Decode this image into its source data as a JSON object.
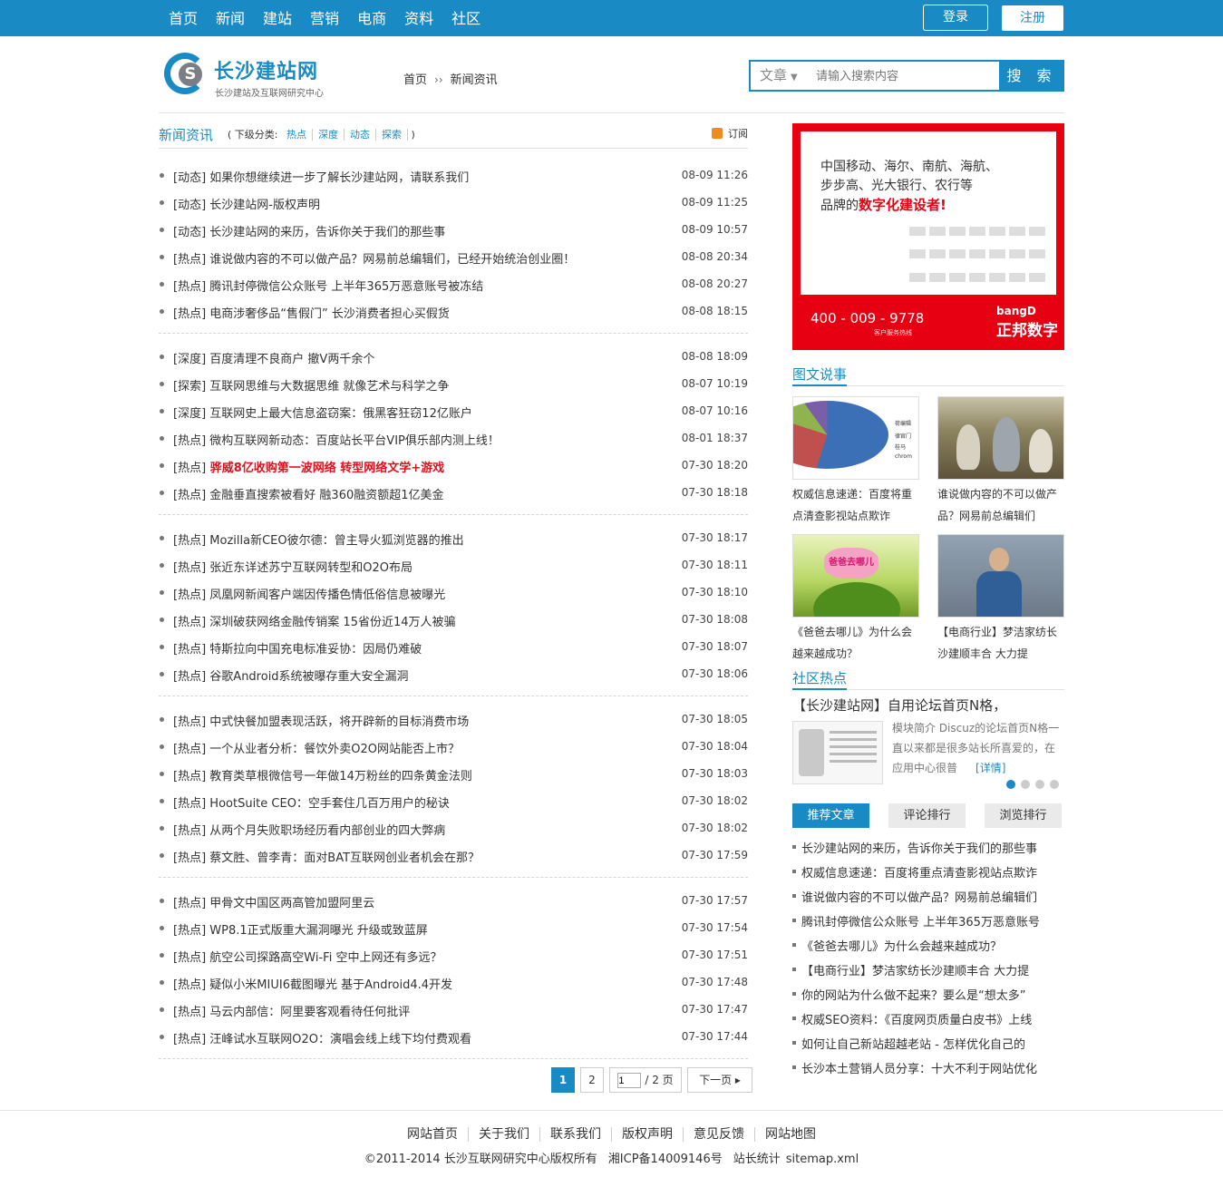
{
  "nav": {
    "items": [
      "首页",
      "新闻",
      "建站",
      "营销",
      "电商",
      "资料",
      "社区"
    ],
    "login": "登录",
    "register": "注册"
  },
  "logo": {
    "icon_letter": "S",
    "name": "长沙建站网",
    "subtitle": "长沙建站及互联网研究中心"
  },
  "breadcrumb": {
    "home": "首页",
    "separator": "››",
    "current": "新闻资讯"
  },
  "search": {
    "type": "文章",
    "placeholder": "请输入搜索内容",
    "button": "搜 索"
  },
  "list": {
    "title": "新闻资讯",
    "subcats_prefix": "( 下级分类:",
    "subcats": [
      "热点",
      "深度",
      "动态",
      "探索"
    ],
    "subcats_suffix": ")",
    "rss": "订阅",
    "groups": [
      [
        {
          "tag": "[动态]",
          "title": "如果你想继续进一步了解长沙建站网，请联系我们",
          "date": "08-09 11:26"
        },
        {
          "tag": "[动态]",
          "title": "长沙建站网-版权声明",
          "date": "08-09 11:25"
        },
        {
          "tag": "[动态]",
          "title": "长沙建站网的来历，告诉你关于我们的那些事",
          "date": "08-09 10:57"
        },
        {
          "tag": "[热点]",
          "title": "谁说做内容的不可以做产品？网易前总编辑们，已经开始统治创业圈！",
          "date": "08-08 20:34"
        },
        {
          "tag": "[热点]",
          "title": "腾讯封停微信公众账号 上半年365万恶意账号被冻结",
          "date": "08-08 20:27"
        },
        {
          "tag": "[热点]",
          "title": "电商涉奢侈品“售假门” 长沙消费者担心买假货",
          "date": "08-08 18:15"
        }
      ],
      [
        {
          "tag": "[深度]",
          "title": "百度清理不良商户 撤V两千余个",
          "date": "08-08 18:09"
        },
        {
          "tag": "[探索]",
          "title": "互联网思维与大数据思维 就像艺术与科学之争",
          "date": "08-07 10:19"
        },
        {
          "tag": "[深度]",
          "title": "互联网史上最大信息盗窃案：俄黑客狂窃12亿账户",
          "date": "08-07 10:16"
        },
        {
          "tag": "[热点]",
          "title": "微构互联网新动态：百度站长平台VIP俱乐部内测上线！",
          "date": "08-01 18:37"
        },
        {
          "tag": "[热点]",
          "title": "骅威8亿收购第一波网络 转型网络文学+游戏",
          "date": "07-30 18:20",
          "red": true
        },
        {
          "tag": "[热点]",
          "title": "金融垂直搜索被看好 融360融资额超1亿美金",
          "date": "07-30 18:18"
        }
      ],
      [
        {
          "tag": "[热点]",
          "title": "Mozilla新CEO彼尔德：曾主导火狐浏览器的推出",
          "date": "07-30 18:17"
        },
        {
          "tag": "[热点]",
          "title": "张近东详述苏宁互联网转型和O2O布局",
          "date": "07-30 18:11"
        },
        {
          "tag": "[热点]",
          "title": "凤凰网新闻客户端因传播色情低俗信息被曝光",
          "date": "07-30 18:10"
        },
        {
          "tag": "[热点]",
          "title": "深圳破获网络金融传销案 15省份近14万人被骗",
          "date": "07-30 18:08"
        },
        {
          "tag": "[热点]",
          "title": "特斯拉向中国充电标准妥协：因局仍难破",
          "date": "07-30 18:07"
        },
        {
          "tag": "[热点]",
          "title": "谷歌Android系统被曝存重大安全漏洞",
          "date": "07-30 18:06"
        }
      ],
      [
        {
          "tag": "[热点]",
          "title": "中式快餐加盟表现活跃，将开辟新的目标消费市场",
          "date": "07-30 18:05"
        },
        {
          "tag": "[热点]",
          "title": "一个从业者分析：餐饮外卖O2O网站能否上市？",
          "date": "07-30 18:04"
        },
        {
          "tag": "[热点]",
          "title": "教育类草根微信号一年做14万粉丝的四条黄金法则",
          "date": "07-30 18:03"
        },
        {
          "tag": "[热点]",
          "title": "HootSuite CEO：空手套住几百万用户的秘诀",
          "date": "07-30 18:02"
        },
        {
          "tag": "[热点]",
          "title": "从两个月失败职场经历看内部创业的四大弊病",
          "date": "07-30 18:02"
        },
        {
          "tag": "[热点]",
          "title": "蔡文胜、曾李青：面对BAT互联网创业者机会在那？",
          "date": "07-30 17:59"
        }
      ],
      [
        {
          "tag": "[热点]",
          "title": "甲骨文中国区两高管加盟阿里云",
          "date": "07-30 17:57"
        },
        {
          "tag": "[热点]",
          "title": "WP8.1正式版重大漏洞曝光 升级或致蓝屏",
          "date": "07-30 17:54"
        },
        {
          "tag": "[热点]",
          "title": "航空公司探路高空Wi-Fi 空中上网还有多远？",
          "date": "07-30 17:51"
        },
        {
          "tag": "[热点]",
          "title": "疑似小米MIUI6截图曝光 基于Android4.4开发",
          "date": "07-30 17:48"
        },
        {
          "tag": "[热点]",
          "title": "马云内部信：阿里要客观看待任何批评",
          "date": "07-30 17:47"
        },
        {
          "tag": "[热点]",
          "title": "汪峰试水互联网O2O：演唱会线上线下均付费观看",
          "date": "07-30 17:44"
        }
      ]
    ]
  },
  "pager": {
    "current": "1",
    "page2": "2",
    "jump_value": "1",
    "jump_total": "/ 2 页",
    "next": "下一页 ▸"
  },
  "ad": {
    "line1": "中国移动、海尔、南航、海航、",
    "line2": "步步高、光大银行、农行等",
    "line3_prefix": "品牌的",
    "line3_highlight": "数字化建设者!",
    "phone": "400 - 009 - 9778",
    "phone_sub": "客户服务热线",
    "brand_en": "bangD",
    "brand_cn": "正邦数字",
    "color_bg": "#e60012"
  },
  "pictures": {
    "title": "图文说事",
    "pie_legend": [
      "荷编辑",
      "律官门",
      "桂马",
      "chrom"
    ],
    "kids_sign": "爸爸去哪儿",
    "items": [
      {
        "cap": "权威信息速递：百度将重点清查影视站点欺诈"
      },
      {
        "cap": "谁说做内容的不可以做产品？网易前总编辑们"
      },
      {
        "cap": "《爸爸去哪儿》为什么会越来越成功？"
      },
      {
        "cap": "【电商行业】梦洁家纺长沙建顺丰合 大力提"
      }
    ]
  },
  "community": {
    "title": "社区热点",
    "headline": "【长沙建站网】自用论坛首页N格，",
    "desc": "模块简介 Discuz的论坛首页N格一直以来都是很多站长所喜爱的，在应用中心很普",
    "more": "[详情]"
  },
  "tabs": [
    "推荐文章",
    "评论排行",
    "浏览排行"
  ],
  "ranking": [
    "长沙建站网的来历，告诉你关于我们的那些事",
    "权威信息速递：百度将重点清查影视站点欺诈",
    "谁说做内容的不可以做产品？网易前总编辑们",
    "腾讯封停微信公众账号 上半年365万恶意账号",
    "《爸爸去哪儿》为什么会越来越成功？",
    "【电商行业】梦洁家纺长沙建顺丰合 大力提",
    "你的网站为什么做不起来？要么是“想太多”",
    "权威SEO资料：《百度网页质量白皮书》上线",
    "如何让自己新站超越老站 - 怎样优化自己的",
    "长沙本土营销人员分享：十大不利于网站优化"
  ],
  "footer": {
    "links": [
      "网站首页",
      "关于我们",
      "联系我们",
      "版权声明",
      "意见反馈",
      "网站地图"
    ],
    "copyright": "©2011-2014 长沙互联网研究中心版权所有",
    "icp": "湘ICP备14009146号",
    "stats": "站长统计",
    "sitemap": "sitemap.xml"
  },
  "colors": {
    "accent": "#1a8ac4",
    "highlight": "#e0101c"
  }
}
